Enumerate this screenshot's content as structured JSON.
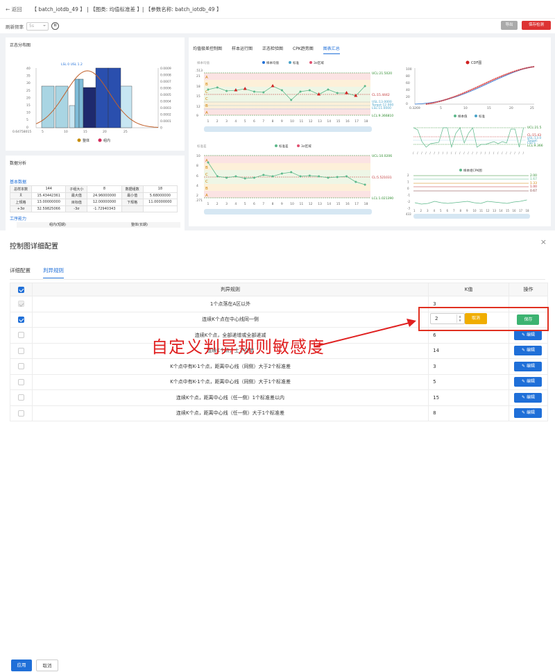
{
  "header": {
    "back": "← 返回",
    "title": "【 batch_iotdb_49 】 | 【图类: 均值标准差 】| 【参数名称: batch_iotdb_49 】"
  },
  "toolbar": {
    "refresh_label": "刷新频率",
    "refresh_value": "5s",
    "btn_export": "导出",
    "btn_save": "保存检测"
  },
  "normal_panel": {
    "title": "正态分布图",
    "marker": "LSL 0  USL 1.2",
    "legend": [
      "整体",
      "组内"
    ],
    "xticks": [
      "0.64758015",
      "5",
      "10",
      "15",
      "20",
      "25"
    ],
    "yticks_right": [
      "0.0009",
      "0.0008",
      "0.0007",
      "0.0006",
      "0.0005",
      "0.0004",
      "0.0003",
      "0.0002",
      "0.0001",
      "0"
    ],
    "yticks_left": [
      "40",
      "35",
      "30",
      "25",
      "20",
      "15",
      "10",
      "5",
      "0"
    ]
  },
  "data_panel": {
    "title": "数据分析",
    "section_basic": "基本数据",
    "rows": [
      [
        "总样本数",
        "144",
        "子组大小",
        "8",
        "数据组数",
        "18"
      ],
      [
        "X̄",
        "15.43442361",
        "最大值",
        "24.96000000",
        "最小值",
        "5.68000000"
      ],
      [
        "上规格",
        "13.00000000",
        "目标值",
        "12.00000000",
        "下规格",
        "11.00000000"
      ],
      [
        "+3σ",
        "32.59825066",
        "-3σ",
        "-1.72940343",
        "",
        ""
      ]
    ],
    "section_capability": "工序能力",
    "cap_cols": [
      "组内(短期)",
      "整体(长期)"
    ]
  },
  "chart_tabs": {
    "items": [
      "均值极差控制图",
      "样本运行图",
      "正态检验图",
      "CPK趋势图",
      "图表汇总"
    ],
    "active": 4
  },
  "xbar_chart": {
    "title": "样本均值",
    "legend": [
      "样本均值",
      "标准",
      "3σ区域"
    ],
    "ucl": "UCL:21.5020",
    "cl": "CL:15.4442",
    "lcl": "LCL:9.366810",
    "usl": "USL:13.0000",
    "target": "Target:12.000",
    "lsl": "LSL:11.0000",
    "yticks": [
      "21",
      "18",
      "15",
      "12",
      "9"
    ],
    "ymax_label": ".513",
    "zones": [
      "A",
      "B",
      "C",
      "C",
      "B",
      "A"
    ],
    "x": [
      "1",
      "2",
      "3",
      "4",
      "5",
      "6",
      "7",
      "8",
      "9",
      "10",
      "11",
      "12",
      "13",
      "14",
      "15",
      "16",
      "17",
      "18"
    ]
  },
  "std_chart": {
    "title": "标准差",
    "legend": [
      "标准差",
      "3σ区域"
    ],
    "ucl": "UCL:10.0206",
    "cl": "CL:5.521031",
    "lcl": "LCL:1.021390",
    "yticks": [
      "10",
      "8",
      "6",
      "4",
      "2"
    ],
    "ymin_label": ".271",
    "zones": [
      "A",
      "B",
      "C",
      "C",
      "B",
      "A"
    ],
    "x": [
      "1",
      "2",
      "3",
      "4",
      "5",
      "6",
      "7",
      "8",
      "9",
      "10",
      "11",
      "12",
      "13",
      "14",
      "15",
      "16",
      "17",
      "18"
    ]
  },
  "cdf_chart": {
    "legend": "CDF图",
    "yticks": [
      "100",
      "80",
      "60",
      "40",
      "20",
      "0"
    ],
    "xticks": [
      "0.3269",
      "5",
      "10",
      "15",
      "20",
      "25"
    ]
  },
  "mini_chart": {
    "legend": [
      "样本值",
      "标准"
    ],
    "labels": [
      "UCL:21.5",
      "CL:15.43",
      "USL:13.0",
      "Target:",
      "LSL:1",
      "LCL:9.366"
    ]
  },
  "cpk_chart": {
    "legend": "样本组CPK图",
    "yticks": [
      "2",
      "1",
      "0",
      "-1",
      "-2",
      "-3"
    ],
    "ymin_label": "433",
    "levels": [
      "2.00",
      "1.67",
      "1.33",
      "1.00",
      "0.67"
    ]
  },
  "modal": {
    "title": "控制图详细配置",
    "close": "×",
    "tabs": [
      "详细配置",
      "判异规则"
    ],
    "active_tab": 1,
    "columns": [
      "判异规则",
      "K值",
      "操作"
    ],
    "rules": [
      {
        "text": "1个点落在A区以外",
        "k": "3",
        "action": "",
        "state": "disabled"
      },
      {
        "text": "连续K个点在中心线同一侧",
        "k": "2",
        "action": "editing",
        "state": "checked"
      },
      {
        "text": "连续K个点，全部递增或全部递减",
        "k": "6",
        "action": "编辑",
        "state": "unchecked"
      },
      {
        "text": "连续K个点，上下交错",
        "k": "14",
        "action": "编辑",
        "state": "unchecked"
      },
      {
        "text": "K个点中有K-1个点，距离中心线（同侧）大于2个标准差",
        "k": "3",
        "action": "编辑",
        "state": "unchecked"
      },
      {
        "text": "K个点中有K-1个点，距离中心线（同侧）大于1个标准差",
        "k": "5",
        "action": "编辑",
        "state": "unchecked"
      },
      {
        "text": "连续K个点，距离中心线（任一侧）1个标准差以内",
        "k": "15",
        "action": "编辑",
        "state": "unchecked"
      },
      {
        "text": "连续K个点，距离中心线（任一侧）大于1个标准差",
        "k": "8",
        "action": "编辑",
        "state": "unchecked"
      }
    ],
    "edit_cancel": "取消",
    "edit_save": "保存",
    "edit_icon": "✎",
    "footer_apply": "应用",
    "footer_cancel": "取消"
  },
  "annotation": "自定义判异规则敏感度",
  "colors": {
    "primary": "#1f6fd8",
    "save": "#3cb371",
    "cancel": "#f0ad00",
    "annotation": "#e02020"
  }
}
